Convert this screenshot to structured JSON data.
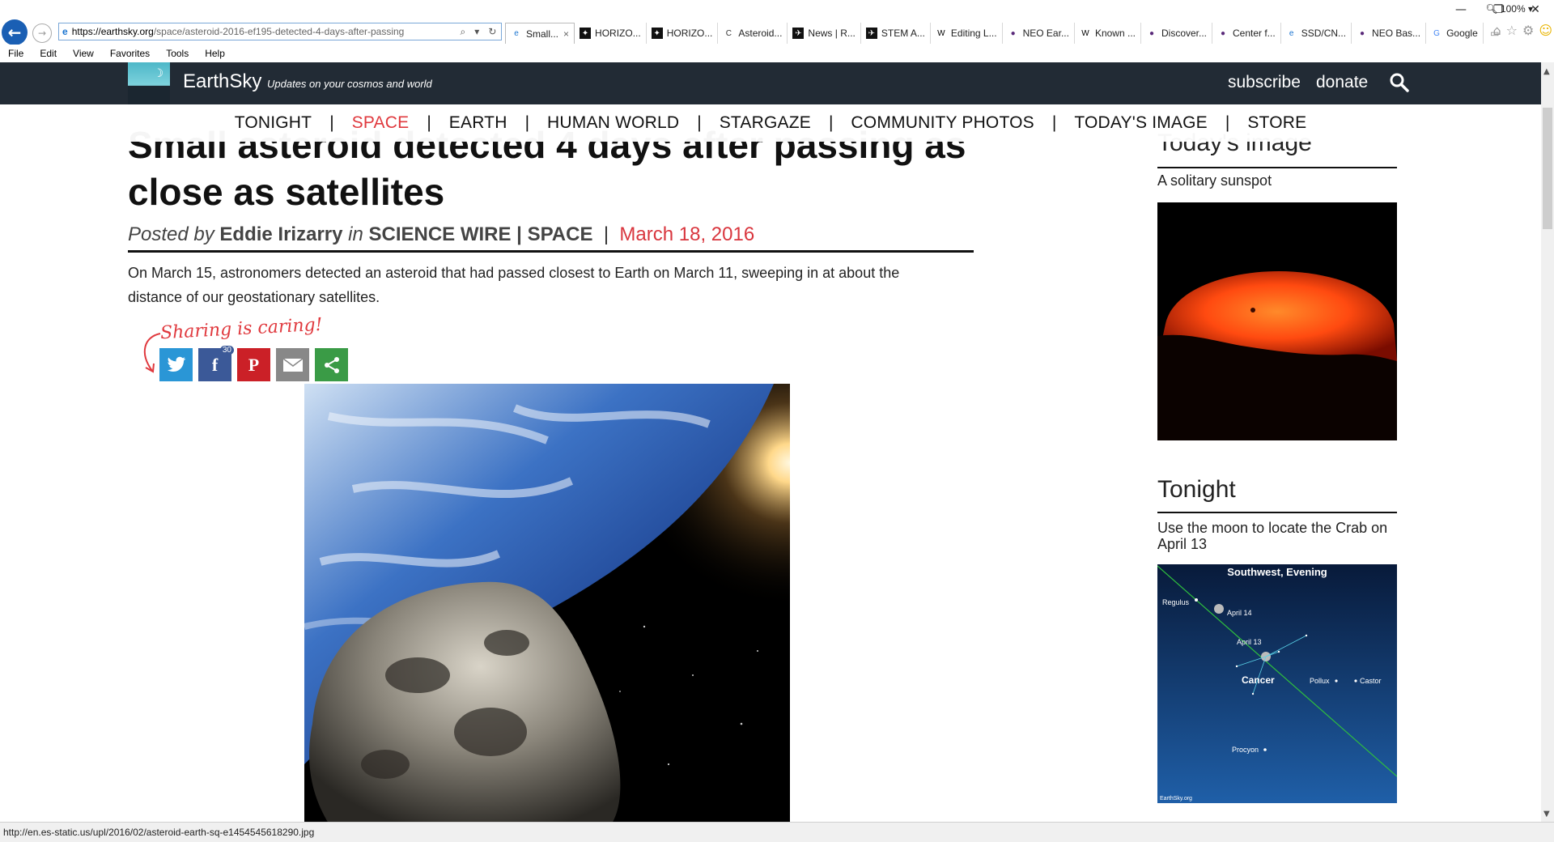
{
  "window": {
    "controls": [
      "—",
      "❐",
      "✕"
    ]
  },
  "browser": {
    "url_host": "https://earthsky.org",
    "url_path": "/space/asteroid-2016-ef195-detected-4-days-after-passing",
    "tabs": [
      {
        "label": "Small...",
        "icon": "ie-icon",
        "active": true
      },
      {
        "label": "HORIZO...",
        "icon": "star-icon"
      },
      {
        "label": "HORIZO...",
        "icon": "star-icon"
      },
      {
        "label": "Asteroid...",
        "icon": "c-icon"
      },
      {
        "label": "News | R...",
        "icon": "rocket-icon"
      },
      {
        "label": "STEM A...",
        "icon": "rocket-icon"
      },
      {
        "label": "Editing L...",
        "icon": "wikipedia-icon"
      },
      {
        "label": "NEO Ear...",
        "icon": "neo-icon"
      },
      {
        "label": "Known ...",
        "icon": "wikipedia-icon"
      },
      {
        "label": "Discover...",
        "icon": "neo-icon"
      },
      {
        "label": "Center f...",
        "icon": "neo-icon"
      },
      {
        "label": "SSD/CN...",
        "icon": "ie-icon"
      },
      {
        "label": "NEO Bas...",
        "icon": "neo-icon"
      },
      {
        "label": "Google",
        "icon": "google-icon"
      }
    ],
    "menu": [
      "File",
      "Edit",
      "View",
      "Favorites",
      "Tools",
      "Help"
    ],
    "status_url": "http://en.es-static.us/upl/2016/02/asteroid-earth-sq-e1454545618290.jpg",
    "zoom": "100%"
  },
  "site": {
    "name": "EarthSky",
    "tagline": "Updates on your cosmos and world",
    "subscribe": "subscribe",
    "donate": "donate",
    "nav": [
      {
        "label": "TONIGHT",
        "active": false
      },
      {
        "label": "SPACE",
        "active": true
      },
      {
        "label": "EARTH",
        "active": false
      },
      {
        "label": "HUMAN WORLD",
        "active": false
      },
      {
        "label": "STARGAZE",
        "active": false
      },
      {
        "label": "COMMUNITY PHOTOS",
        "active": false
      },
      {
        "label": "TODAY'S IMAGE",
        "active": false
      },
      {
        "label": "STORE",
        "active": false
      }
    ]
  },
  "article": {
    "title": "Small asteroid detected 4 days after passing as close as satellites",
    "posted_by_label": "Posted by",
    "author": "Eddie Irizarry",
    "in_label": "in",
    "categories": "SCIENCE WIRE | SPACE",
    "date": "March 18, 2016",
    "summary": "On March 15, astronomers detected an asteroid that had passed closest to Earth on March 11, sweeping in at about the distance of our geostationary satellites.",
    "sharing_label": "Sharing is caring!",
    "facebook_count": "30"
  },
  "sidebar": {
    "todays_image_heading": "Today's image",
    "todays_image_caption": "A solitary sunspot",
    "tonight_heading": "Tonight",
    "tonight_caption": "Use the moon to locate the Crab on April 13",
    "chart": {
      "title": "Southwest, Evening",
      "labels": {
        "regulus": "Regulus",
        "april14": "April 14",
        "april13": "April 13",
        "cancer": "Cancer",
        "pollux": "Pollux",
        "castor": "Castor",
        "procyon": "Procyon",
        "credit": "EarthSky.org"
      }
    }
  }
}
